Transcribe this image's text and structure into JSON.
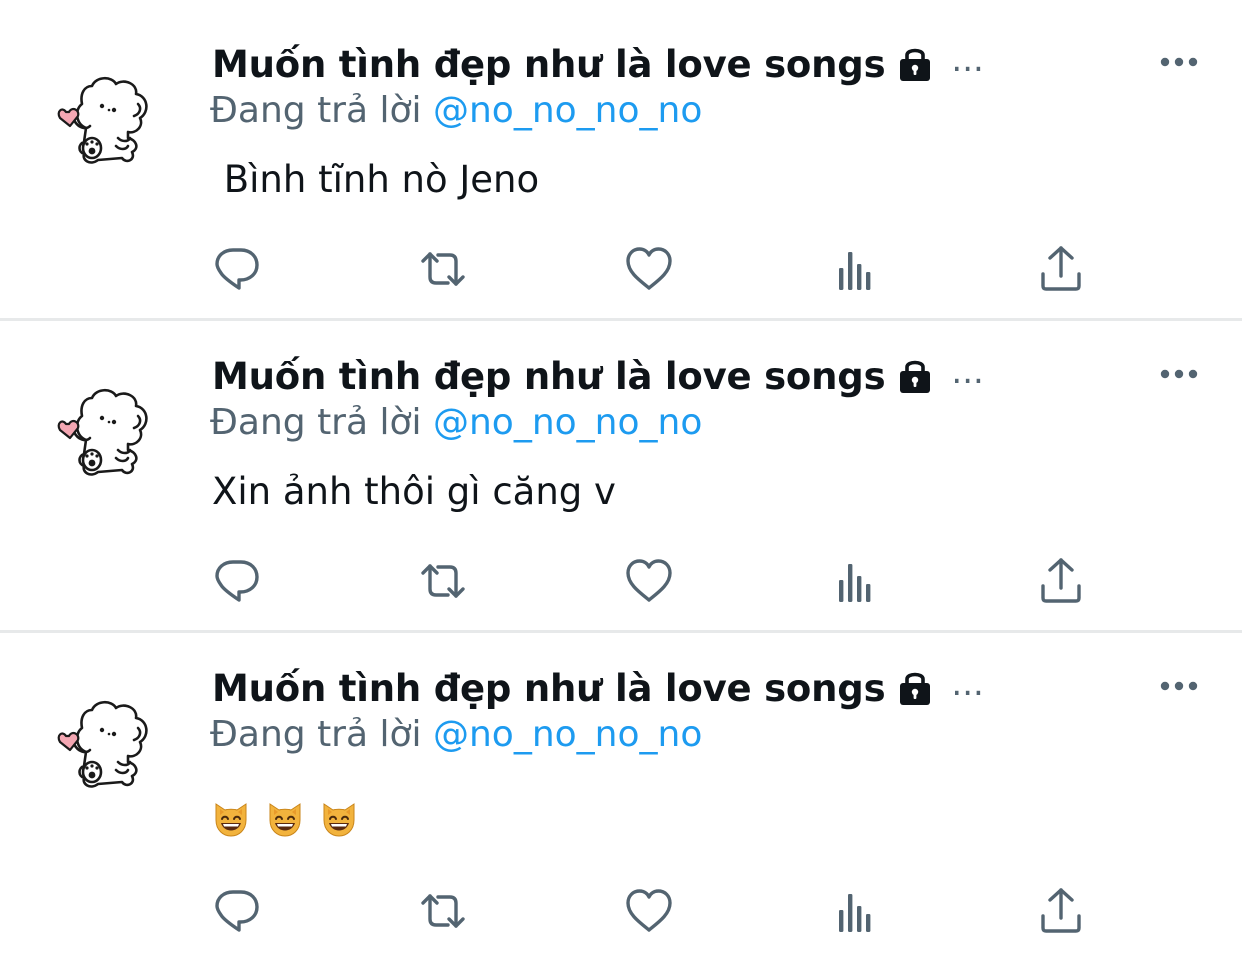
{
  "tweets": [
    {
      "display_name": "Muốn tình đẹp như là love songs",
      "name_overflow": "...",
      "reply_prefix": "Đang trả lời",
      "reply_handle": "@no_no_no_no",
      "text": " Bình tĩnh nò Jeno",
      "emojis": []
    },
    {
      "display_name": "Muốn tình đẹp như là love songs",
      "name_overflow": "...",
      "reply_prefix": "Đang trả lời",
      "reply_handle": "@no_no_no_no",
      "text": "Xin ảnh thôi gì căng v",
      "emojis": []
    },
    {
      "display_name": "Muốn tình đẹp như là love songs",
      "name_overflow": "...",
      "reply_prefix": "Đang trả lời",
      "reply_handle": "@no_no_no_no",
      "text": "",
      "emojis": [
        "smiling-cat-emoji",
        "smiling-cat-emoji",
        "smiling-cat-emoji"
      ]
    }
  ],
  "icons": {
    "lock": "lock-icon",
    "more": "more-icon",
    "reply": "reply-icon",
    "retweet": "retweet-icon",
    "like": "heart-icon",
    "views": "analytics-icon",
    "share": "share-icon"
  },
  "colors": {
    "text": "#0f1419",
    "secondary": "#536471",
    "link": "#1d9bf0",
    "divider": "#e7e9ea",
    "heart_accent": "#f4a7b3"
  }
}
